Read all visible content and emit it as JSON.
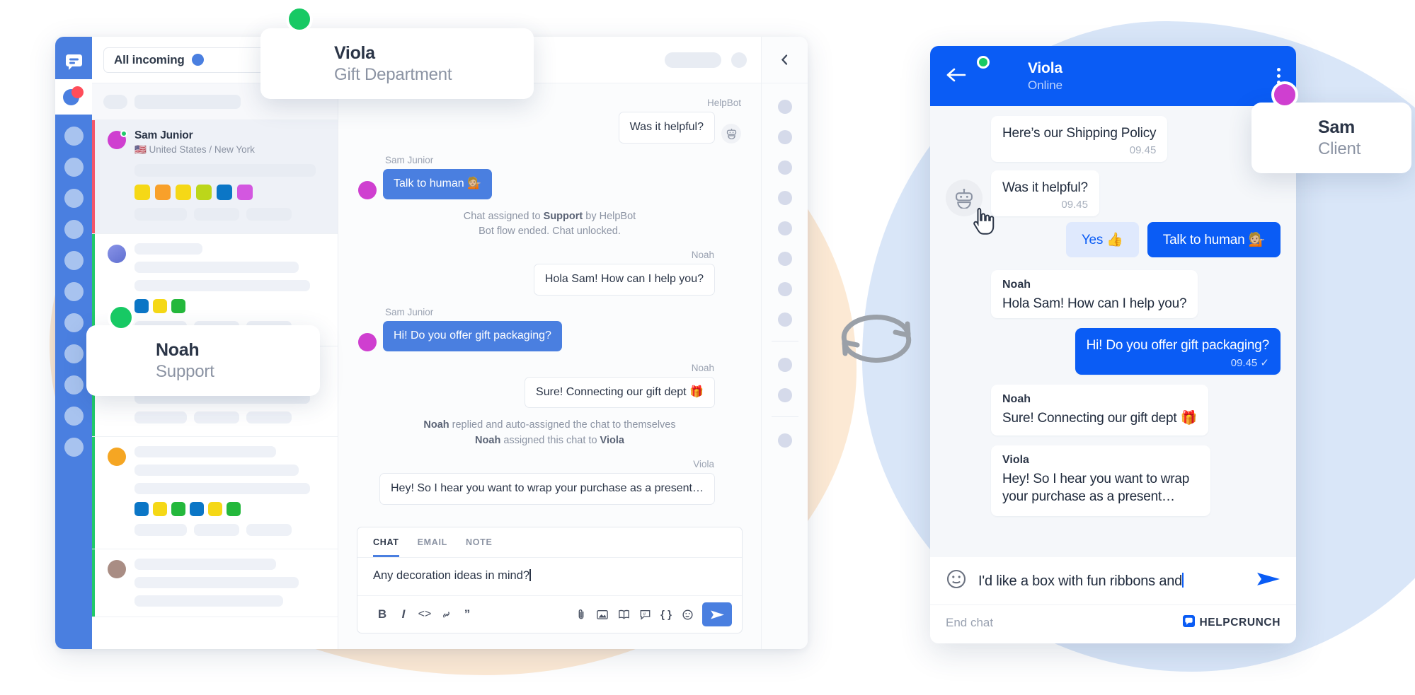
{
  "brand": {
    "accent_blue": "#4a7fe0",
    "widget_blue": "#0a5cf5",
    "green": "#20c96a",
    "red": "#ff4d5a",
    "magenta": "#cf3fd0",
    "name": "HELPCRUNCH"
  },
  "desktop": {
    "rail": {
      "logo_icon": "chat-logo-icon",
      "active_icon": "contacts-icon",
      "placeholder_count": 5
    },
    "conversations": {
      "filter": {
        "label": "All incoming",
        "status_dot_color": "#4a7fe0"
      },
      "items": [
        {
          "name": "Sam Junior",
          "location": "🇺🇸 United States / New York",
          "avatar_color": "#cf3fd0",
          "presence": "online",
          "stripe_color": "#f4566a",
          "selected": true,
          "tags": [
            "#f5d816",
            "#f8a02a",
            "#f5d816",
            "#bcd61a",
            "#0b76c6",
            "#d357e0"
          ]
        },
        {
          "name": "",
          "location": "",
          "avatar_color": "#6f7fd8",
          "stripe_color": "#21c96a",
          "selected": false,
          "tags": [
            "#0b76c6",
            "#f5d816",
            "#24b83c"
          ]
        },
        {
          "name": "",
          "location": "",
          "avatar_color": "#cf3fd0",
          "stripe_color": "#21c96a",
          "selected": false,
          "tags": [
            "#0b76c6",
            "#f5d816",
            "#24b83c",
            "#0b76c6",
            "#f5d816",
            "#24b83c"
          ]
        },
        {
          "name": "",
          "location": "",
          "avatar_color": "#f5a623",
          "stripe_color": "#21c96a",
          "selected": false,
          "tags": [
            "#0b76c6",
            "#f5d816",
            "#24b83c",
            "#0b76c6",
            "#f5d816",
            "#24b83c"
          ]
        },
        {
          "name": "",
          "location": "",
          "avatar_color": "#a98d84",
          "stripe_color": "#21c96a",
          "selected": false,
          "tags": []
        }
      ]
    },
    "chat": {
      "collapse_icon": "chevron-left-icon",
      "messages": [
        {
          "kind": "bubble",
          "sender": "HelpBot",
          "side": "out",
          "style": "bot",
          "text": "Was it helpful?",
          "avatar": "bot-icon"
        },
        {
          "kind": "bubble",
          "sender": "Sam Junior",
          "side": "in",
          "style": "client",
          "text": "Talk to human 💁🏼",
          "avatar": "client-dot"
        },
        {
          "kind": "system",
          "line1_pre": "Chat assigned to ",
          "line1_bold": "Support",
          "line1_post": " by HelpBot",
          "line2": "Bot flow ended. Chat unlocked."
        },
        {
          "kind": "bubble",
          "sender": "Noah",
          "side": "out",
          "style": "agent",
          "text": "Hola Sam! How can I help you?",
          "avatar": "noah-avatar"
        },
        {
          "kind": "bubble",
          "sender": "Sam Junior",
          "side": "in",
          "style": "client",
          "text": "Hi! Do you offer gift packaging?",
          "avatar": "client-dot"
        },
        {
          "kind": "bubble",
          "sender": "Noah",
          "side": "out",
          "style": "agent",
          "text": "Sure! Connecting our gift dept 🎁",
          "avatar": "noah-avatar"
        },
        {
          "kind": "system2",
          "l1_bold": "Noah",
          "l1_rest": " replied and auto-assigned the chat to themselves",
          "l2_bold": "Noah",
          "l2_mid": " assigned this chat to ",
          "l2_bold2": "Viola"
        },
        {
          "kind": "bubble",
          "sender": "Viola",
          "side": "out",
          "style": "agent",
          "text": "Hey! So I hear you want to wrap your purchase as a present…",
          "avatar": "viola-avatar"
        }
      ],
      "composer": {
        "tabs": [
          {
            "label": "CHAT",
            "active": true
          },
          {
            "label": "EMAIL",
            "active": false
          },
          {
            "label": "NOTE",
            "active": false
          }
        ],
        "value": "Any decoration ideas in mind?",
        "format_tools": [
          "bold-icon",
          "italic-icon",
          "code-icon",
          "link-icon",
          "quote-icon"
        ],
        "format_glyphs": [
          "B",
          "I",
          "<>",
          "⮠",
          "”"
        ],
        "action_tools": [
          "attachment-icon",
          "image-icon",
          "knowledge-base-icon",
          "canned-response-icon",
          "variable-icon",
          "emoji-icon"
        ],
        "action_glyphs": [
          "📎",
          "▣",
          "◫",
          "⊞",
          "{ }",
          "☻"
        ],
        "send_icon": "send-icon"
      }
    },
    "details_rail": {
      "collapse_icon": "chevron-left-icon",
      "placeholder_dots": 11
    }
  },
  "cards": [
    {
      "name": "Viola",
      "role": "Gift Department",
      "presence": "online",
      "presence_color": "#17c964",
      "photo": "ph-viola"
    },
    {
      "name": "Noah",
      "role": "Support",
      "presence": "online",
      "presence_color": "#17c964",
      "photo": "ph-noah"
    },
    {
      "name": "Sam",
      "role": "Client",
      "presence": "client",
      "presence_color": "#cf3fd0",
      "photo": "ph-sam"
    }
  ],
  "sync_icon": "sync-arrows-icon",
  "widget": {
    "header": {
      "back_icon": "arrow-left-icon",
      "name": "Viola",
      "status": "Online",
      "menu_icon": "kebab-menu-icon",
      "avatar": "viola-avatar"
    },
    "messages": [
      {
        "kind": "bubble",
        "side": "in",
        "sender": "",
        "text": "Here’s our Shipping Policy",
        "time": "09.45",
        "avatar": "none"
      },
      {
        "kind": "bubble",
        "side": "in",
        "sender": "",
        "text": "Was it helpful?",
        "time": "09.45",
        "avatar": "bot-icon"
      },
      {
        "kind": "quick",
        "buttons": [
          {
            "label": "Yes 👍",
            "style": "ghost"
          },
          {
            "label": "Talk to human 💁🏼",
            "style": "solid",
            "cursor": true
          }
        ]
      },
      {
        "kind": "bubble",
        "side": "in",
        "sender": "Noah",
        "text": "Hola Sam! How can I help you?",
        "time": "",
        "avatar": "noah-avatar"
      },
      {
        "kind": "bubble",
        "side": "out",
        "sender": "",
        "text": "Hi! Do you offer gift packaging?",
        "time": "09.45 ✓",
        "avatar": "none"
      },
      {
        "kind": "bubble",
        "side": "in",
        "sender": "Noah",
        "text": "Sure! Connecting our gift dept 🎁",
        "time": "",
        "avatar": "noah-avatar"
      },
      {
        "kind": "bubble",
        "side": "in",
        "sender": "Viola",
        "text": "Hey! So I hear you want to wrap your purchase as a present…",
        "time": "",
        "avatar": "viola-avatar"
      }
    ],
    "composer": {
      "emoji_icon": "emoji-icon",
      "value": "I'd like a box with fun ribbons and",
      "send_icon": "send-icon"
    },
    "footer": {
      "end_chat": "End chat",
      "brand": "HELPCRUNCH",
      "brand_icon": "helpcrunch-logo-icon"
    }
  }
}
